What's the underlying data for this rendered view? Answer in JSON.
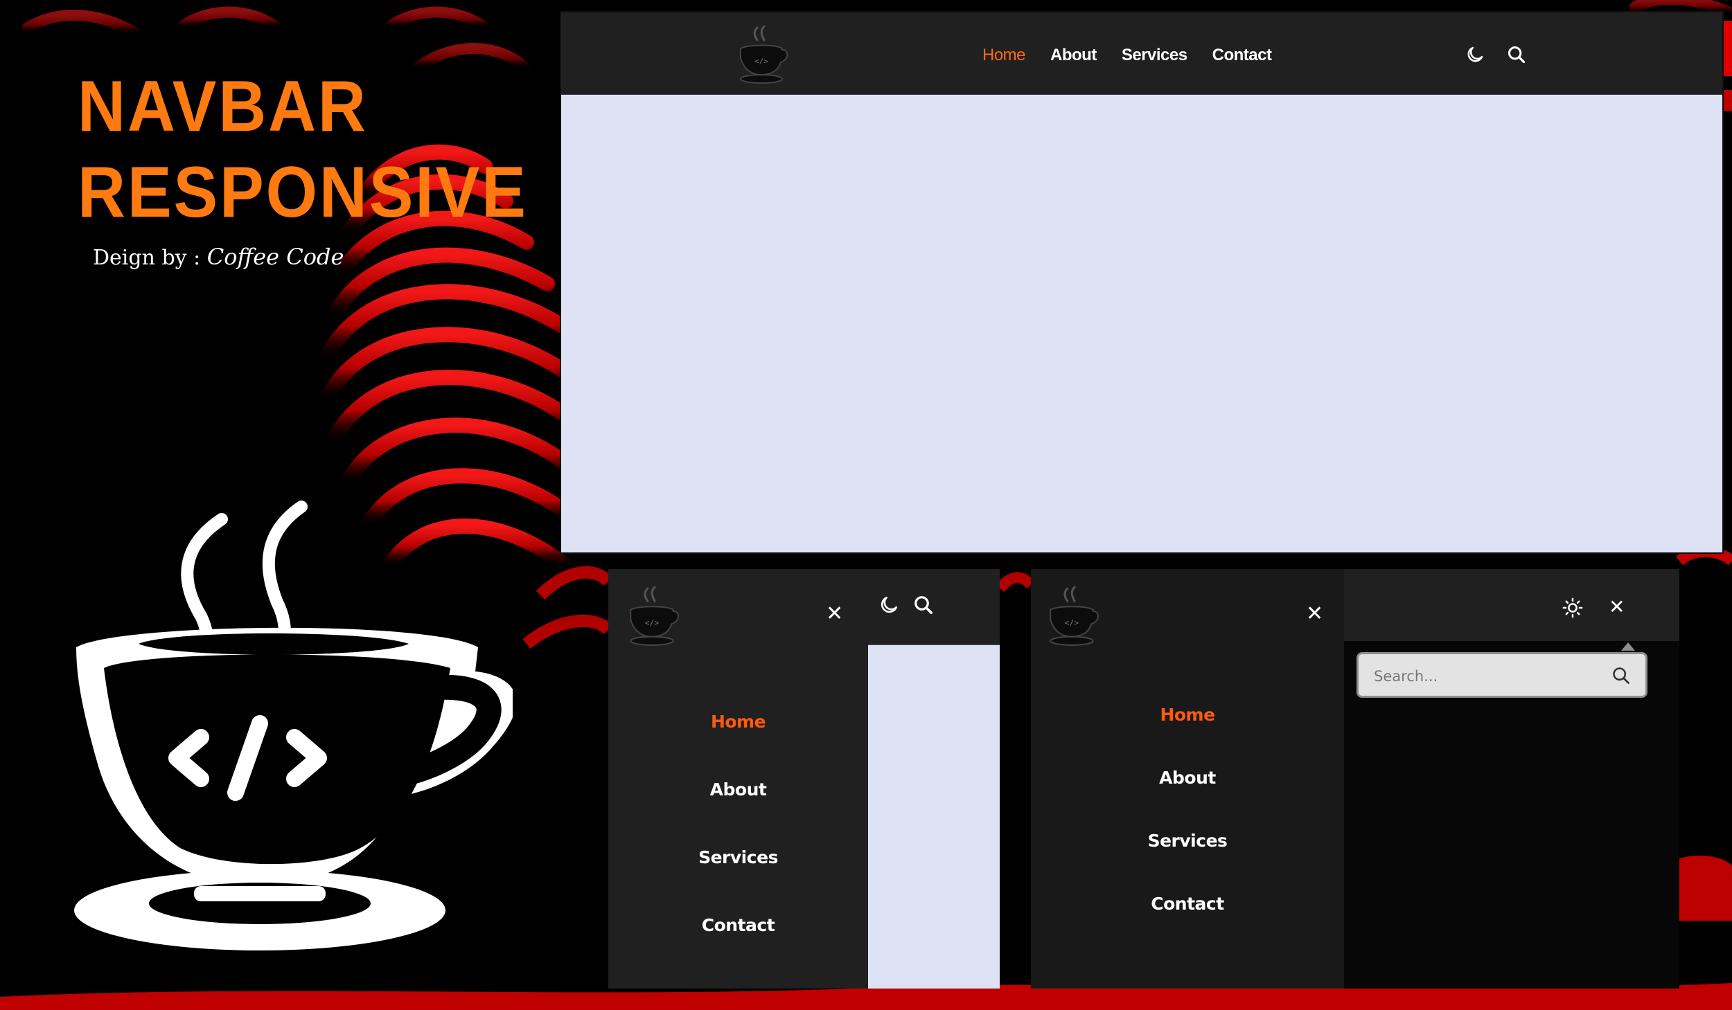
{
  "hero": {
    "title_line1": "NAVBAR",
    "title_line2": "RESPONSIVE",
    "credit_prefix": "Deign by : ",
    "credit_brand": "Coffee Code"
  },
  "desktop": {
    "nav": {
      "links": [
        {
          "label": "Home",
          "active": true
        },
        {
          "label": "About",
          "active": false
        },
        {
          "label": "Services",
          "active": false
        },
        {
          "label": "Contact",
          "active": false
        }
      ],
      "icons": [
        "coffee-code-logo",
        "moon-icon",
        "search-icon"
      ]
    }
  },
  "mobile_menu_open": {
    "close_label": "✕",
    "links": [
      {
        "label": "Home",
        "active": true
      },
      {
        "label": "About",
        "active": false
      },
      {
        "label": "Services",
        "active": false
      },
      {
        "label": "Contact",
        "active": false
      }
    ],
    "icons": [
      "coffee-code-logo",
      "close-icon",
      "moon-icon",
      "search-icon"
    ]
  },
  "mobile_search_open": {
    "close_label": "✕",
    "links": [
      {
        "label": "Home",
        "active": true
      },
      {
        "label": "About",
        "active": false
      },
      {
        "label": "Services",
        "active": false
      },
      {
        "label": "Contact",
        "active": false
      }
    ],
    "search_placeholder": "Search...",
    "icons": [
      "coffee-code-logo",
      "close-icon",
      "sun-icon",
      "search-icon"
    ]
  },
  "colors": {
    "accent": "#ff7a10",
    "active_link": "#ff6a10",
    "nav_bg": "#202020",
    "content_bg": "#dde2f5",
    "wave_red": "#e00000"
  }
}
